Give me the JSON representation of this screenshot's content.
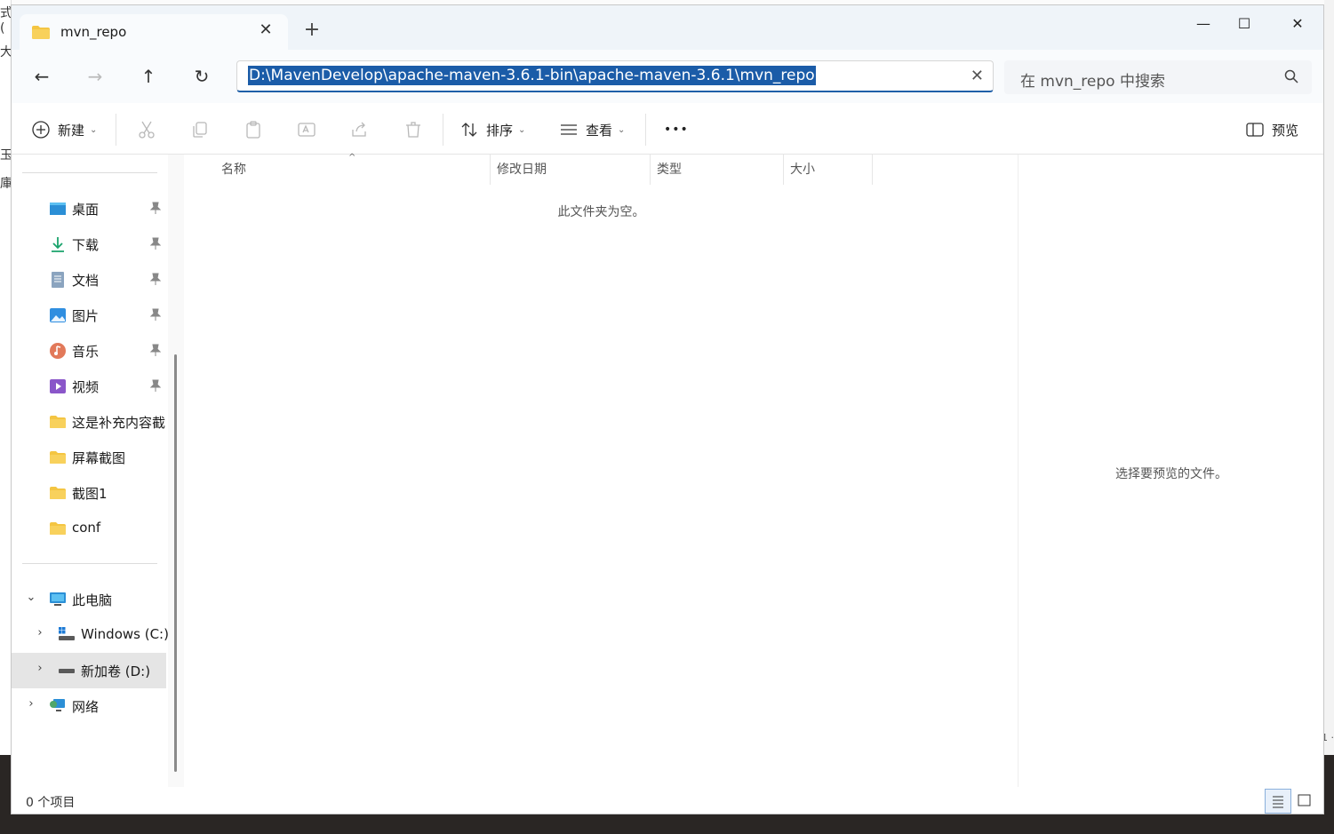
{
  "background": {
    "left_fragments": [
      "式(",
      "大",
      "玉",
      "庫"
    ],
    "right_fragment": "1 ·"
  },
  "tab": {
    "title": "mvn_repo",
    "icon": "folder-icon",
    "close_glyph": "✕"
  },
  "new_tab_glyph": "+",
  "window_controls": {
    "minimize": "—",
    "maximize": "☐",
    "close": "✕"
  },
  "nav": {
    "back": "←",
    "forward": "→",
    "up": "↑",
    "refresh": "↻",
    "address": "D:\\MavenDevelop\\apache-maven-3.6.1-bin\\apache-maven-3.6.1\\mvn_repo",
    "address_clear": "✕",
    "search_placeholder": "在 mvn_repo 中搜索"
  },
  "commands": {
    "new_label": "新建",
    "sort_label": "排序",
    "view_label": "查看",
    "more_label": "•••",
    "preview_label": "预览",
    "chevron": "⌄"
  },
  "sidebar": {
    "quick_access": [
      {
        "label": "桌面",
        "icon": "desktop-icon",
        "pinned": true
      },
      {
        "label": "下载",
        "icon": "download-icon",
        "pinned": true
      },
      {
        "label": "文档",
        "icon": "document-icon",
        "pinned": true
      },
      {
        "label": "图片",
        "icon": "pictures-icon",
        "pinned": true
      },
      {
        "label": "音乐",
        "icon": "music-icon",
        "pinned": true
      },
      {
        "label": "视频",
        "icon": "video-icon",
        "pinned": true
      },
      {
        "label": "这是补充内容截",
        "icon": "folder-icon",
        "pinned": false
      },
      {
        "label": "屏幕截图",
        "icon": "folder-icon",
        "pinned": false
      },
      {
        "label": "截图1",
        "icon": "folder-icon",
        "pinned": false
      },
      {
        "label": "conf",
        "icon": "folder-icon",
        "pinned": false
      }
    ],
    "this_pc": {
      "label": "此电脑",
      "expanded_glyph": "⌄"
    },
    "drives": [
      {
        "label": "Windows (C:)",
        "glyph": "›"
      },
      {
        "label": "新加卷 (D:)",
        "glyph": "›",
        "selected": true
      }
    ],
    "network": {
      "label": "网络",
      "glyph": "›"
    }
  },
  "columns": [
    "名称",
    "修改日期",
    "类型",
    "大小"
  ],
  "sort_indicator": "^",
  "empty_message": "此文件夹为空。",
  "preview_message": "选择要预览的文件。",
  "status": {
    "item_count": "0 个项目"
  },
  "colors": {
    "accent": "#1b5ca8",
    "folder": "#f4c542",
    "selected": "#e5e5e5"
  }
}
